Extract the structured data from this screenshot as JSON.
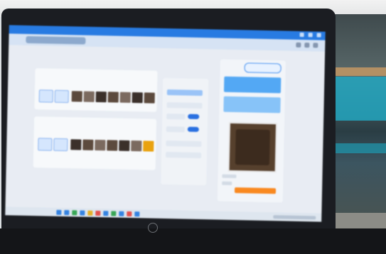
{
  "scene": {
    "description_label": "",
    "laptop_brand_mark": "hp"
  },
  "screen_app": {
    "window_title": "",
    "app_chip_label": "",
    "section_a_label": "",
    "section_b_label": "",
    "side_panel_title": "",
    "right_panel_tag": ""
  },
  "colors": {
    "titlebar": "#2f7ad8",
    "accent_blue": "#5aa7ec",
    "accent_orange": "#f08a2b",
    "selected_thumb": "#e3a21c"
  },
  "icons": {
    "upload": "upload-icon",
    "toggle": "toggle-switch",
    "brand": "hp-logo"
  }
}
